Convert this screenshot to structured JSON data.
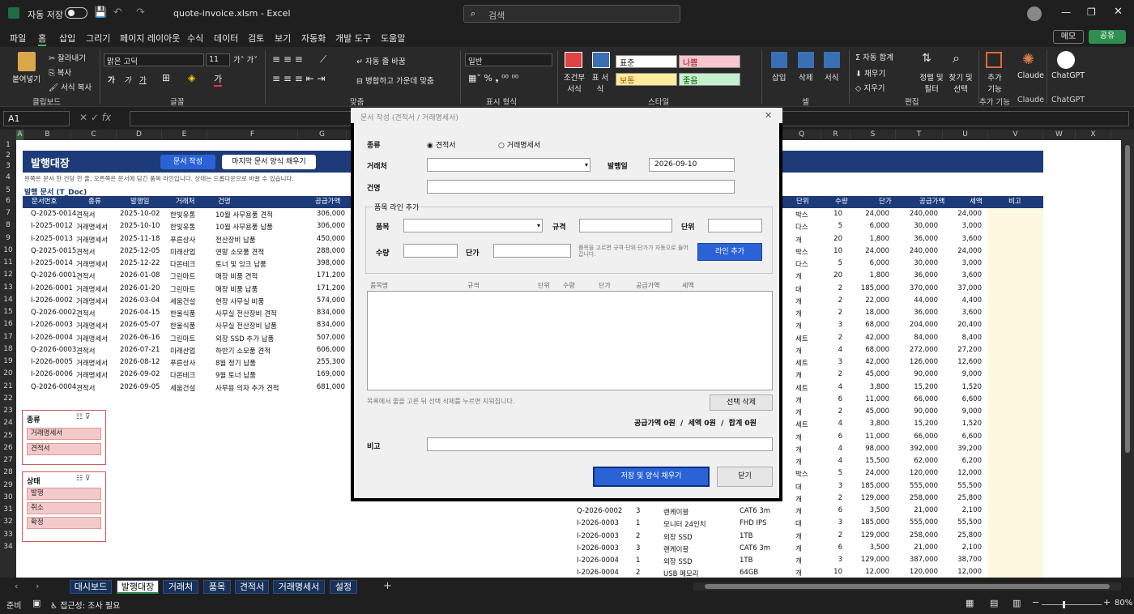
{
  "titlebar": {
    "autosave_label": "자동 저장",
    "filename": "quote-invoice.xlsm",
    "app": "Excel",
    "search_placeholder": "검색"
  },
  "menu": [
    "파일",
    "홈",
    "삽입",
    "그리기",
    "페이지 레이아웃",
    "수식",
    "데이터",
    "검토",
    "보기",
    "자동화",
    "개발 도구",
    "도움말"
  ],
  "menu_right": {
    "memo": "메모",
    "share": "공유"
  },
  "ribbon": {
    "paste": "붙여넣기",
    "cut": "잘라내기",
    "copy": "복사",
    "format_painter": "서식 복사",
    "clipboard": "클립보드",
    "font_name": "맑은 고딕",
    "font_size": "11",
    "font_group": "글꼴",
    "wrap": "자동 줄 바꿈",
    "merge": "병합하고 가운데 맞춤",
    "align_group": "맞춤",
    "num_format": "일반",
    "number_group": "표시 형식",
    "cond_format": "조건부 서식",
    "table_format": "표 서식",
    "style_normal": "표준",
    "style_bad": "나쁨",
    "style_neutral": "보통",
    "style_good": "좋음",
    "style_group": "스타일",
    "insert": "삽입",
    "delete": "삭제",
    "format": "서식",
    "cells_group": "셀",
    "autosum": "자동 합계",
    "fill": "채우기",
    "clear": "지우기",
    "sort": "정렬 및 필터",
    "find": "찾기 및 선택",
    "edit_group": "편집",
    "addins": "추가 기능",
    "addins_group": "추가 기능",
    "claude": "Claude",
    "claude_group": "Claude",
    "chatgpt": "ChatGPT",
    "chatgpt_group": "ChatGPT"
  },
  "namebox": "A1",
  "columns": [
    "A",
    "B",
    "C",
    "D",
    "E",
    "F",
    "G",
    "Q",
    "R",
    "S",
    "T",
    "U",
    "V",
    "W",
    "X"
  ],
  "rows": [
    "1",
    "2",
    "3",
    "4",
    "5",
    "6",
    "7",
    "8",
    "9",
    "10",
    "11",
    "12",
    "13",
    "14",
    "15",
    "16",
    "17",
    "18",
    "19",
    "20",
    "21",
    "22",
    "23",
    "24",
    "25",
    "26",
    "27",
    "28",
    "29",
    "30",
    "31",
    "32",
    "33",
    "34"
  ],
  "sheet": {
    "title": "발행대장",
    "btn_create": "문서 작성",
    "btn_fill_last": "마지막 문서 양식 채우기",
    "note": "왼쪽은 문서 한 건당 한 줄, 오른쪽은 문서에 담긴 품목 라인입니다. 상태는 드롭다운으로 바꿀 수 있습니다.",
    "section": "발행 문서 (T_Doc)",
    "left_headers": [
      "문서번호",
      "종류",
      "발행일",
      "거래처",
      "건명",
      "공급가액"
    ],
    "left_rows": [
      [
        "Q-2025-0014",
        "견적서",
        "2025-10-02",
        "한빛유통",
        "10월 사무용품 견적",
        "306,000"
      ],
      [
        "I-2025-0012",
        "거래명세서",
        "2025-10-10",
        "한빛유통",
        "10월 사무용품 납품",
        "306,000"
      ],
      [
        "I-2025-0013",
        "거래명세서",
        "2025-11-18",
        "푸른상사",
        "전산장비 납품",
        "450,000"
      ],
      [
        "Q-2025-0015",
        "견적서",
        "2025-12-05",
        "미래산업",
        "연말 소모품 견적",
        "288,000"
      ],
      [
        "I-2025-0014",
        "거래명세서",
        "2025-12-22",
        "다온테크",
        "토너 및 잉크 납품",
        "398,000"
      ],
      [
        "Q-2026-0001",
        "견적서",
        "2026-01-08",
        "그린마트",
        "매장 비품 견적",
        "171,200"
      ],
      [
        "I-2026-0001",
        "거래명세서",
        "2026-01-20",
        "그린마트",
        "매장 비품 납품",
        "171,200"
      ],
      [
        "I-2026-0002",
        "거래명세서",
        "2026-03-04",
        "세움건설",
        "현장 사무실 비품",
        "574,000"
      ],
      [
        "Q-2026-0002",
        "견적서",
        "2026-04-15",
        "한울식품",
        "사무실 전산장비 견적",
        "834,000"
      ],
      [
        "I-2026-0003",
        "거래명세서",
        "2026-05-07",
        "한울식품",
        "사무실 전산장비 납품",
        "834,000"
      ],
      [
        "I-2026-0004",
        "거래명세서",
        "2026-06-16",
        "그린마트",
        "외장 SSD 추가 납품",
        "507,000"
      ],
      [
        "Q-2026-0003",
        "견적서",
        "2026-07-21",
        "미래산업",
        "하반기 소모품 견적",
        "606,000"
      ],
      [
        "I-2026-0005",
        "거래명세서",
        "2026-08-12",
        "푸른상사",
        "8월 정기 납품",
        "255,300"
      ],
      [
        "I-2026-0006",
        "거래명세서",
        "2026-09-02",
        "다온테크",
        "9월 토너 납품",
        "169,000"
      ],
      [
        "Q-2026-0004",
        "견적서",
        "2026-09-05",
        "세움건설",
        "사무용 의자 추가 견적",
        "681,000"
      ]
    ],
    "right_headers": [
      "단위",
      "수량",
      "단가",
      "공급가액",
      "세액",
      "비고"
    ],
    "right_rows": [
      [
        "박스",
        "10",
        "24,000",
        "240,000",
        "24,000"
      ],
      [
        "다스",
        "5",
        "6,000",
        "30,000",
        "3,000"
      ],
      [
        "개",
        "20",
        "1,800",
        "36,000",
        "3,600"
      ],
      [
        "박스",
        "10",
        "24,000",
        "240,000",
        "24,000"
      ],
      [
        "다스",
        "5",
        "6,000",
        "30,000",
        "3,000"
      ],
      [
        "개",
        "20",
        "1,800",
        "36,000",
        "3,600"
      ],
      [
        "대",
        "2",
        "185,000",
        "370,000",
        "37,000"
      ],
      [
        "개",
        "2",
        "22,000",
        "44,000",
        "4,400"
      ],
      [
        "개",
        "2",
        "18,000",
        "36,000",
        "3,600"
      ],
      [
        "개",
        "3",
        "68,000",
        "204,000",
        "20,400"
      ],
      [
        "세트",
        "2",
        "42,000",
        "84,000",
        "8,400"
      ],
      [
        "개",
        "4",
        "68,000",
        "272,000",
        "27,200"
      ],
      [
        "세트",
        "3",
        "42,000",
        "126,000",
        "12,600"
      ],
      [
        "개",
        "2",
        "45,000",
        "90,000",
        "9,000"
      ],
      [
        "세트",
        "4",
        "3,800",
        "15,200",
        "1,520"
      ],
      [
        "개",
        "6",
        "11,000",
        "66,000",
        "6,600"
      ],
      [
        "개",
        "2",
        "45,000",
        "90,000",
        "9,000"
      ],
      [
        "세트",
        "4",
        "3,800",
        "15,200",
        "1,520"
      ],
      [
        "개",
        "6",
        "11,000",
        "66,000",
        "6,600"
      ],
      [
        "개",
        "4",
        "98,000",
        "392,000",
        "39,200"
      ],
      [
        "개",
        "4",
        "15,500",
        "62,000",
        "6,200"
      ],
      [
        "박스",
        "5",
        "24,000",
        "120,000",
        "12,000"
      ],
      [
        "대",
        "3",
        "185,000",
        "555,000",
        "55,500"
      ],
      [
        "개",
        "2",
        "129,000",
        "258,000",
        "25,800"
      ],
      [
        "개",
        "6",
        "3,500",
        "21,000",
        "2,100"
      ],
      [
        "대",
        "3",
        "185,000",
        "555,000",
        "55,500"
      ],
      [
        "개",
        "2",
        "129,000",
        "258,000",
        "25,800"
      ],
      [
        "개",
        "6",
        "3,500",
        "21,000",
        "2,100"
      ],
      [
        "개",
        "3",
        "129,000",
        "387,000",
        "38,700"
      ],
      [
        "개",
        "10",
        "12,000",
        "120,000",
        "12,000"
      ]
    ],
    "mid_rows": [
      [
        "Q-2026-0002",
        "3",
        "랜케이블",
        "CAT6 3m"
      ],
      [
        "I-2026-0003",
        "1",
        "모니터 24인치",
        "FHD IPS"
      ],
      [
        "I-2026-0003",
        "2",
        "외장 SSD",
        "1TB"
      ],
      [
        "I-2026-0003",
        "3",
        "랜케이블",
        "CAT6 3m"
      ],
      [
        "I-2026-0004",
        "1",
        "외장 SSD",
        "1TB"
      ],
      [
        "I-2026-0004",
        "2",
        "USB 메모리",
        "64GB"
      ]
    ],
    "slicer1": {
      "title": "종류",
      "items": [
        "거래명세서",
        "견적서"
      ]
    },
    "slicer2": {
      "title": "상태",
      "items": [
        "발행",
        "취소",
        "확정"
      ]
    }
  },
  "dialog": {
    "title": "문서 작성 (견적서 / 거래명세서)",
    "type_label": "종류",
    "type_quote": "견적서",
    "type_invoice": "거래명세서",
    "client_label": "거래처",
    "date_label": "발행일",
    "date_value": "2026-09-10",
    "subject_label": "건명",
    "frame_title": "품목 라인 추가",
    "item_label": "품목",
    "spec_label": "규격",
    "unit_label": "단위",
    "qty_label": "수량",
    "price_label": "단가",
    "hint": "품목을 고르면 규격·단위·단가가 자동으로 들어갑니다.",
    "add_line": "라인 추가",
    "list_headers": [
      "품목명",
      "규격",
      "단위",
      "수량",
      "단가",
      "공급가액",
      "세액"
    ],
    "list_hint": "목록에서 줄을 고른 뒤 선택 삭제를 누르면 지워집니다.",
    "delete_sel": "선택 삭제",
    "totals": "공급가액 0원  /  세액 0원  /  합계 0원",
    "memo_label": "비고",
    "save_btn": "저장 및 양식 채우기",
    "close_btn": "닫기"
  },
  "tabs": [
    "대시보드",
    "발행대장",
    "거래처",
    "품목",
    "견적서",
    "거래명세서",
    "설정"
  ],
  "status": {
    "ready": "준비",
    "accessibility": "접근성: 조사 필요",
    "zoom": "80%"
  }
}
